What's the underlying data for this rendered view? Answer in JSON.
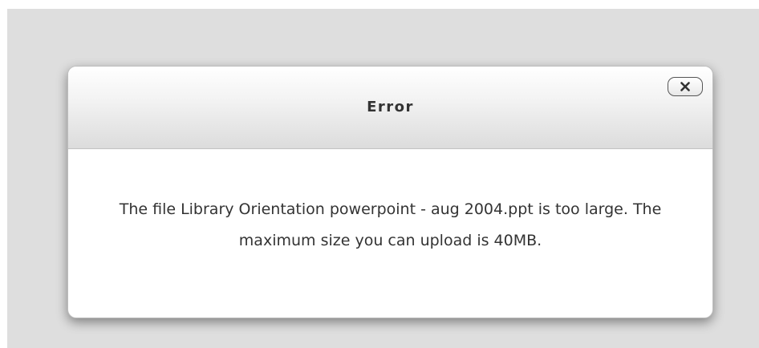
{
  "dialog": {
    "title": "Error",
    "close_icon": "close-x-icon",
    "message": "The file Library Orientation powerpoint - aug 2004.ppt is too large. The maximum size you can upload is 40MB."
  },
  "colors": {
    "backdrop": "#dedede",
    "dialog_background": "#ffffff",
    "text": "#333333",
    "close_border": "#555555"
  }
}
